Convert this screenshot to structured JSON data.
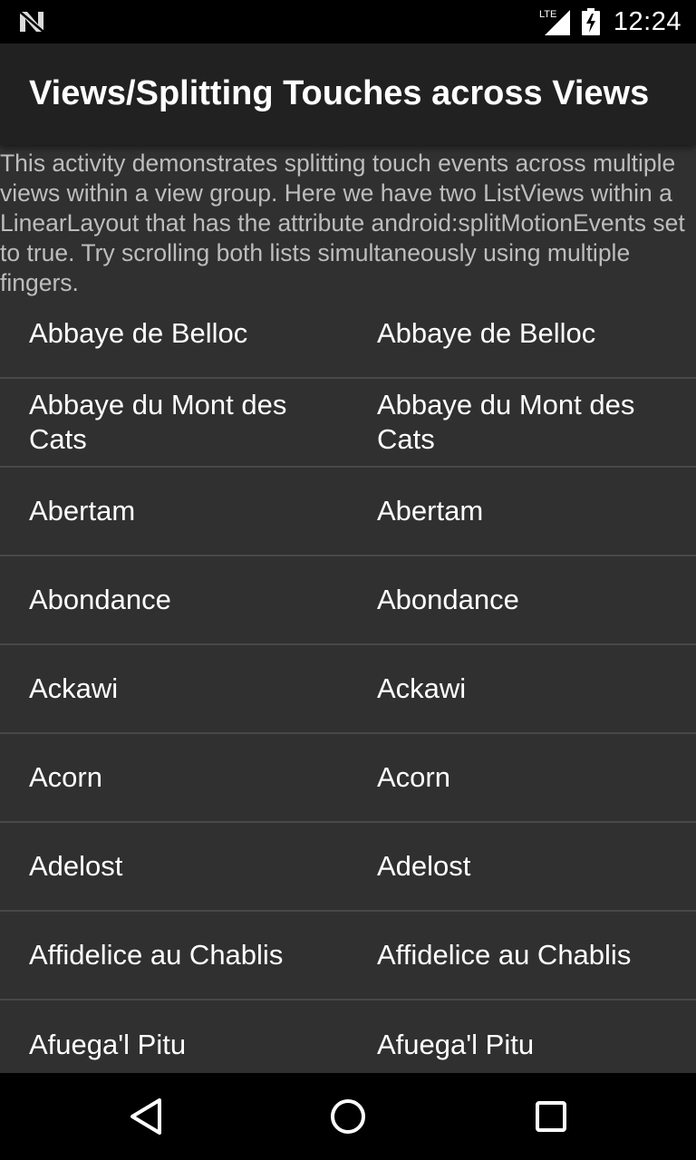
{
  "status_bar": {
    "time": "12:24",
    "network_label": "LTE",
    "left_icon": "n-logo-icon",
    "signal_icon": "cell-signal-icon",
    "battery_icon": "battery-charging-icon"
  },
  "app_bar": {
    "title": "Views/Splitting Touches across Views"
  },
  "description": "This activity demonstrates splitting touch events across multiple views within a view group. Here we have two ListViews within a LinearLayout that has the attribute android:splitMotionEvents set to true. Try scrolling both lists simultaneously using multiple fingers.",
  "left_list": {
    "items": [
      "Abbaye de Belloc",
      "Abbaye du Mont des Cats",
      "Abertam",
      "Abondance",
      "Ackawi",
      "Acorn",
      "Adelost",
      "Affidelice au Chablis",
      "Afuega'l Pitu"
    ]
  },
  "right_list": {
    "items": [
      "Abbaye de Belloc",
      "Abbaye du Mont des Cats",
      "Abertam",
      "Abondance",
      "Ackawi",
      "Acorn",
      "Adelost",
      "Affidelice au Chablis",
      "Afuega'l Pitu"
    ]
  },
  "nav_bar": {
    "back_icon": "back-triangle-icon",
    "home_icon": "home-circle-icon",
    "recents_icon": "recents-square-icon"
  }
}
